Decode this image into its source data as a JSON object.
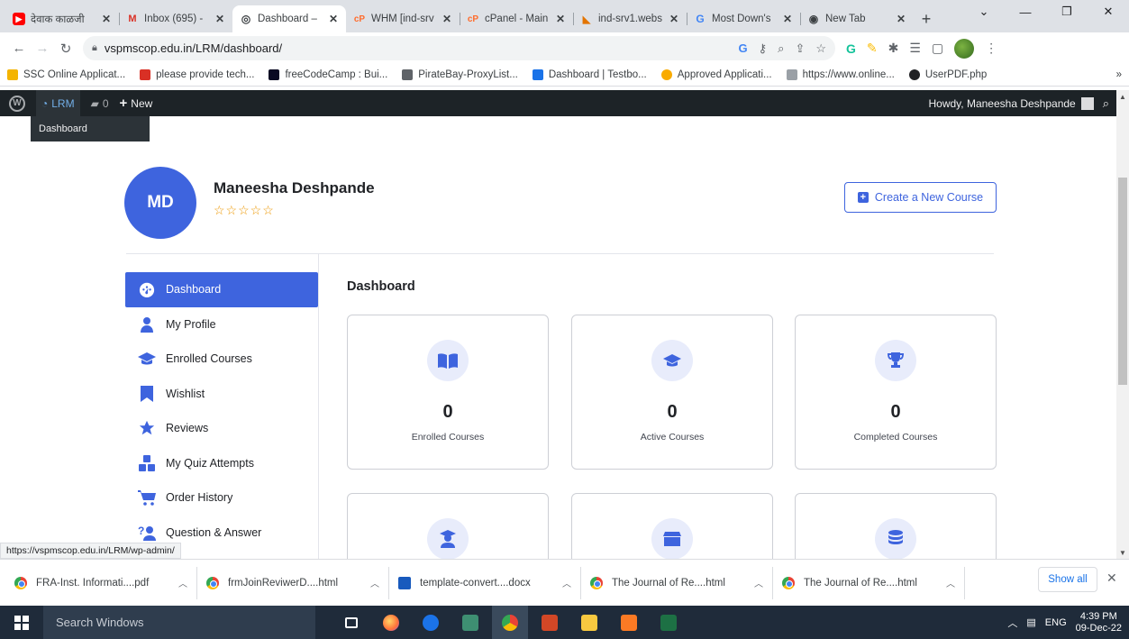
{
  "browser": {
    "tabs": [
      {
        "title": "देवाक काळजी",
        "color": "#ff0000",
        "glyph": "▶"
      },
      {
        "title": "Inbox (695) -",
        "color": "#ffffff",
        "glyph": "M"
      },
      {
        "title": "Dashboard –",
        "color": "#ffffff",
        "glyph": "◎",
        "active": true
      },
      {
        "title": "WHM [ind-srv",
        "color": "#ff6c2c",
        "glyph": "cP"
      },
      {
        "title": "cPanel - Main",
        "color": "#ff6c2c",
        "glyph": "cP"
      },
      {
        "title": "ind-srv1.webs",
        "color": "#ffffff",
        "glyph": "◣"
      },
      {
        "title": "Most Down's",
        "color": "#ffffff",
        "glyph": "G"
      },
      {
        "title": "New Tab",
        "color": "#ffffff",
        "glyph": "◉"
      }
    ],
    "url": "vspmscop.edu.in/LRM/dashboard/",
    "bookmarks": [
      {
        "label": "SSC Online Applicat...",
        "color": "#f4b400"
      },
      {
        "label": "please provide tech...",
        "color": "#d93025"
      },
      {
        "label": "freeCodeCamp : Bui...",
        "color": "#0a0a23"
      },
      {
        "label": "PirateBay-ProxyList...",
        "color": "#5f6368"
      },
      {
        "label": "Dashboard | Testbo...",
        "color": "#1a73e8"
      },
      {
        "label": "Approved Applicati...",
        "color": "#f9ab00"
      },
      {
        "label": "https://www.online...",
        "color": "#9aa0a6"
      },
      {
        "label": "UserPDF.php",
        "color": "#202124"
      }
    ],
    "bookmarks_more": "»",
    "status_url": "https://vspmscop.edu.in/LRM/wp-admin/"
  },
  "adminbar": {
    "site": "LRM",
    "comments": "0",
    "new": "New",
    "howdy": "Howdy, Maneesha Deshpande",
    "submenu": "Dashboard"
  },
  "profile": {
    "initials": "MD",
    "name": "Maneesha Deshpande",
    "stars": "☆☆☆☆☆",
    "create_button": "Create a New Course"
  },
  "sidebar": {
    "items": [
      {
        "label": "Dashboard",
        "icon": "dashboard-icon",
        "active": true
      },
      {
        "label": "My Profile",
        "icon": "user-icon"
      },
      {
        "label": "Enrolled Courses",
        "icon": "graduation-cap-icon"
      },
      {
        "label": "Wishlist",
        "icon": "bookmark-icon"
      },
      {
        "label": "Reviews",
        "icon": "star-icon"
      },
      {
        "label": "My Quiz Attempts",
        "icon": "quiz-icon"
      },
      {
        "label": "Order History",
        "icon": "cart-icon"
      },
      {
        "label": "Question & Answer",
        "icon": "question-icon"
      }
    ]
  },
  "main": {
    "title": "Dashboard",
    "cards": [
      {
        "value": "0",
        "label": "Enrolled Courses",
        "icon": "book-icon"
      },
      {
        "value": "0",
        "label": "Active Courses",
        "icon": "graduation-cap-icon"
      },
      {
        "value": "0",
        "label": "Completed Courses",
        "icon": "trophy-icon"
      },
      {
        "value": "",
        "label": "",
        "icon": "student-icon"
      },
      {
        "value": "",
        "label": "",
        "icon": "box-icon"
      },
      {
        "value": "",
        "label": "",
        "icon": "coins-icon"
      }
    ]
  },
  "downloads": {
    "items": [
      {
        "name": "FRA-Inst. Informati....pdf",
        "type": "chrome"
      },
      {
        "name": "frmJoinReviwerD....html",
        "type": "chrome"
      },
      {
        "name": "template-convert....docx",
        "type": "doc"
      },
      {
        "name": "The Journal of Re....html",
        "type": "chrome"
      },
      {
        "name": "The Journal of Re....html",
        "type": "chrome"
      }
    ],
    "show_all": "Show all"
  },
  "taskbar": {
    "search_placeholder": "Search Windows",
    "language": "ENG",
    "time": "4:39 PM",
    "date": "09-Dec-22"
  },
  "colors": {
    "accent": "#3e64de",
    "adminbar": "#1d2327",
    "taskbar": "#1f2b3a"
  }
}
